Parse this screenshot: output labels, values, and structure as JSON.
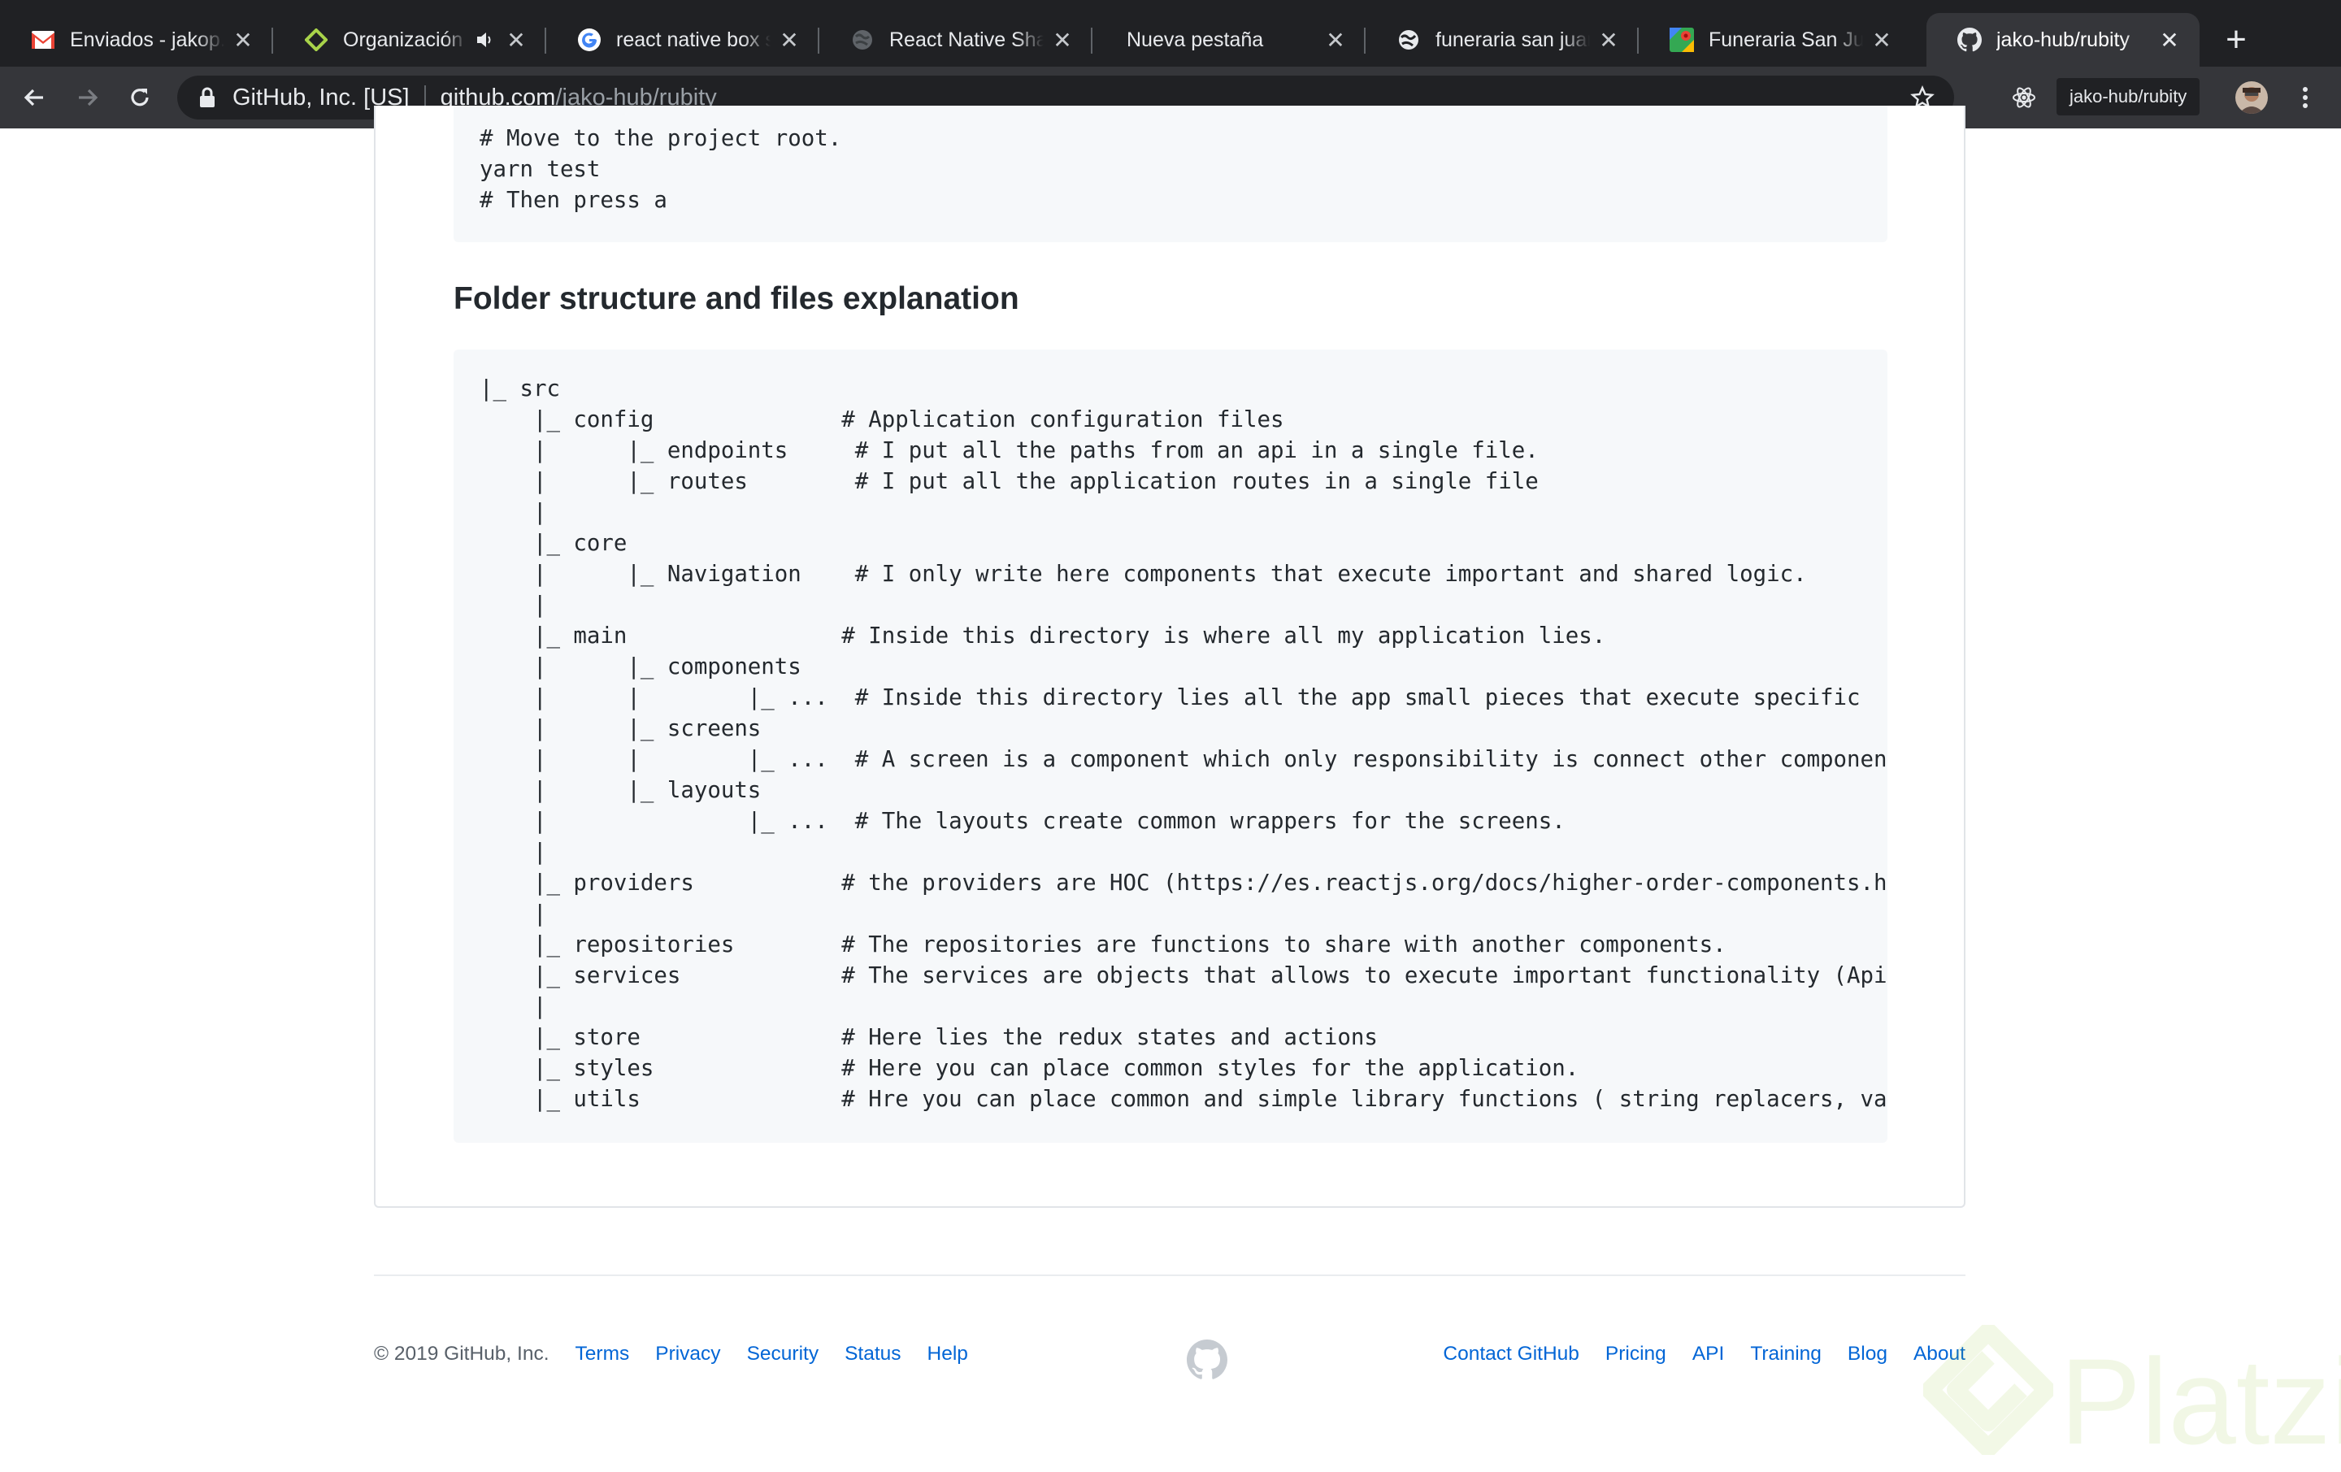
{
  "browser": {
    "tabs": [
      {
        "title": "Enviados - jakop.b",
        "favicon": "gmail-icon"
      },
      {
        "title": "Organización de",
        "favicon": "diamond-icon",
        "audio": true
      },
      {
        "title": "react native box shadow",
        "favicon": "google-icon"
      },
      {
        "title": "React Native Shadow",
        "favicon": "globe-gray-icon"
      },
      {
        "title": "Nueva pestaña",
        "favicon": "none"
      },
      {
        "title": "funeraria san juan",
        "favicon": "globe-icon"
      },
      {
        "title": "Funeraria San Juan",
        "favicon": "maps-icon"
      },
      {
        "title": "jako-hub/rubity",
        "favicon": "github-icon",
        "active": true
      }
    ],
    "address": {
      "org": "GitHub, Inc. [US]",
      "host": "github.com",
      "path": "/jako-hub/rubity"
    },
    "extension_chip": "jako-hub/rubity"
  },
  "readme": {
    "top_code": "# Move to the project root.\nyarn test\n# Then press a",
    "section_title": "Folder structure and files explanation",
    "folder_code": "|_ src\n    |_ config              # Application configuration files\n    |      |_ endpoints     # I put all the paths from an api in a single file.\n    |      |_ routes        # I put all the application routes in a single file\n    |\n    |_ core\n    |      |_ Navigation    # I only write here components that execute important and shared logic.\n    |\n    |_ main                # Inside this directory is where all my application lies.\n    |      |_ components\n    |      |        |_ ...  # Inside this directory lies all the app small pieces that execute specific  tasks\n    |      |_ screens\n    |      |        |_ ...  # A screen is a component which only responsibility is connect other components\n    |      |_ layouts\n    |               |_ ...  # The layouts create common wrappers for the screens.\n    |\n    |_ providers           # the providers are HOC (https://es.reactjs.org/docs/higher-order-components.html)\n    |\n    |_ repositories        # The repositories are functions to share with another components.\n    |_ services            # The services are objects that allows to execute important functionality (Api calls)\n    |\n    |_ store               # Here lies the redux states and actions\n    |_ styles              # Here you can place common styles for the application.\n    |_ utils               # Hre you can place common and simple library functions ( string replacers, validators)"
  },
  "footer": {
    "copyright": "© 2019 GitHub, Inc.",
    "left_links": [
      "Terms",
      "Privacy",
      "Security",
      "Status",
      "Help"
    ],
    "right_links": [
      "Contact GitHub",
      "Pricing",
      "API",
      "Training",
      "Blog",
      "About"
    ]
  },
  "watermark": {
    "text": "Platzi",
    "color": "#98ca3f"
  },
  "colors": {
    "link": "#0366d6",
    "text": "#24292e",
    "code_bg": "#f6f8fa",
    "chrome_dark": "#202124",
    "chrome_toolbar": "#35363a"
  }
}
